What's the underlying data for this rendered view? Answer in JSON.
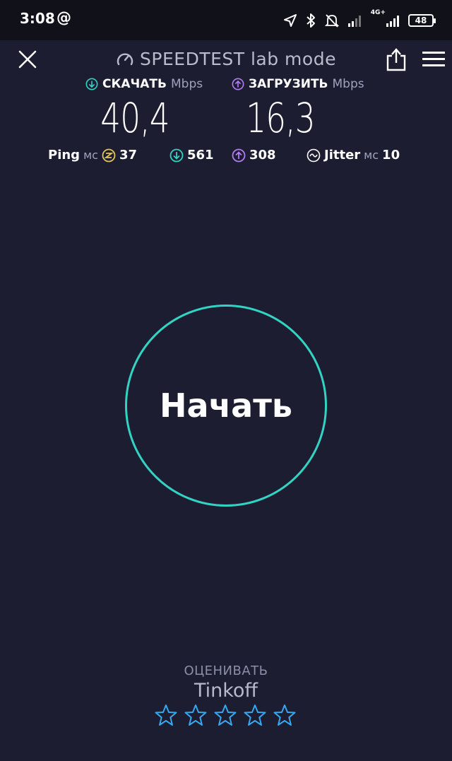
{
  "status_bar": {
    "time": "3:08",
    "at_symbol": "@",
    "network": "4G+",
    "battery": "48"
  },
  "header": {
    "title": "SPEEDTEST lab mode"
  },
  "download": {
    "label": "СКАЧАТЬ",
    "unit": "Mbps",
    "value": "40,4"
  },
  "upload": {
    "label": "ЗАГРУЗИТЬ",
    "unit": "Mbps",
    "value": "16,3"
  },
  "ping": {
    "label": "Ping",
    "unit": "мс",
    "idle": "37",
    "download": "561",
    "upload": "308"
  },
  "jitter": {
    "label": "Jitter",
    "unit": "мс",
    "value": "10"
  },
  "start_button": {
    "label": "Начать"
  },
  "rating": {
    "label": "ОЦЕНИВАТЬ",
    "provider": "Tinkoff",
    "stars": 5
  },
  "colors": {
    "background": "#1c1d30",
    "accent_teal": "#33d3c4",
    "upload_purple": "#b57cf5",
    "ping_gold": "#e4c45b",
    "star_blue": "#37a7f0"
  }
}
